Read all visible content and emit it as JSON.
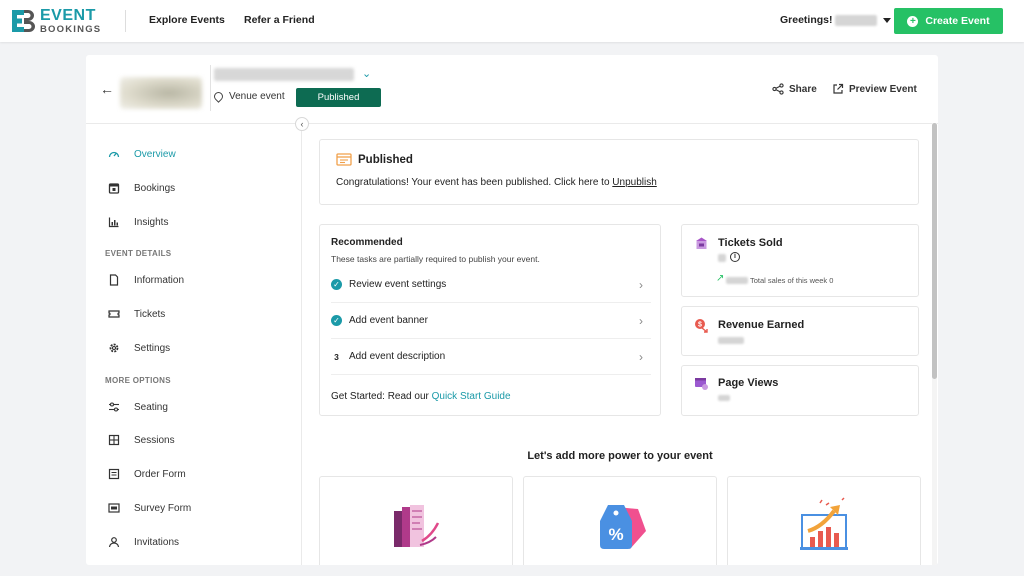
{
  "brand": {
    "line1": "EVENT",
    "line2": "BOOKINGS",
    "accent": "#1b9aa8"
  },
  "nav": {
    "explore": "Explore Events",
    "refer": "Refer a Friend",
    "greeting": "Greetings!",
    "create": "Create Event"
  },
  "event": {
    "venue_label": "Venue event",
    "status": "Published",
    "share": "Share",
    "preview": "Preview Event"
  },
  "sidebar": {
    "items": [
      "Overview",
      "Bookings",
      "Insights"
    ],
    "details_heading": "EVENT DETAILS",
    "details": [
      "Information",
      "Tickets",
      "Settings"
    ],
    "more_heading": "MORE OPTIONS",
    "more": [
      "Seating",
      "Sessions",
      "Order Form",
      "Survey Form",
      "Invitations"
    ]
  },
  "published_card": {
    "title": "Published",
    "message": "Congratulations! Your event has been published. Click here to ",
    "link": "Unpublish"
  },
  "recommended": {
    "title": "Recommended",
    "subtitle": "These tasks are partially required to publish your event.",
    "tasks": [
      {
        "label": "Review event settings",
        "marker": "✓"
      },
      {
        "label": "Add event banner",
        "marker": "✓"
      },
      {
        "label": "Add event description",
        "marker": "3"
      }
    ],
    "footer": "Get Started: Read our ",
    "footer_link": "Quick Start Guide"
  },
  "stats": {
    "tickets_title": "Tickets Sold",
    "tickets_week": "Total sales of this week 0",
    "revenue_title": "Revenue Earned",
    "views_title": "Page Views"
  },
  "power_title": "Let's add more power to your event",
  "colors": {
    "create_green": "#26c165",
    "published_green": "#0d6b52"
  }
}
